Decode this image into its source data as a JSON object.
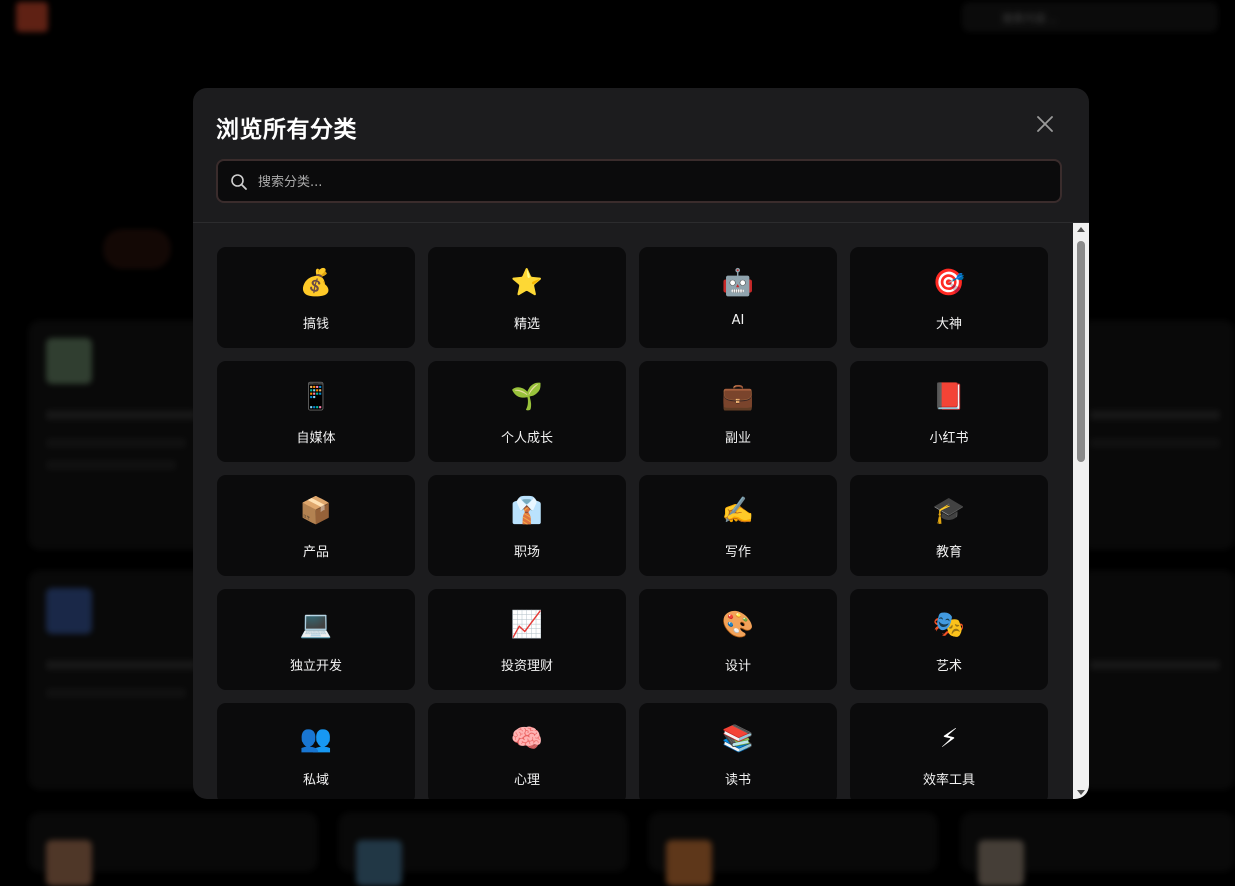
{
  "background": {
    "search_placeholder": "搜索内容..."
  },
  "modal": {
    "title": "浏览所有分类",
    "search": {
      "placeholder": "搜索分类...",
      "value": ""
    },
    "categories": [
      {
        "emoji": "💰",
        "label": "搞钱"
      },
      {
        "emoji": "⭐",
        "label": "精选"
      },
      {
        "emoji": "🤖",
        "label": "AI"
      },
      {
        "emoji": "🎯",
        "label": "大神"
      },
      {
        "emoji": "📱",
        "label": "自媒体"
      },
      {
        "emoji": "🌱",
        "label": "个人成长"
      },
      {
        "emoji": "💼",
        "label": "副业"
      },
      {
        "emoji": "📕",
        "label": "小红书"
      },
      {
        "emoji": "📦",
        "label": "产品"
      },
      {
        "emoji": "👔",
        "label": "职场"
      },
      {
        "emoji": "✍️",
        "label": "写作"
      },
      {
        "emoji": "🎓",
        "label": "教育"
      },
      {
        "emoji": "💻",
        "label": "独立开发"
      },
      {
        "emoji": "📈",
        "label": "投资理财"
      },
      {
        "emoji": "🎨",
        "label": "设计"
      },
      {
        "emoji": "🎭",
        "label": "艺术"
      },
      {
        "emoji": "👥",
        "label": "私域"
      },
      {
        "emoji": "🧠",
        "label": "心理"
      },
      {
        "emoji": "📚",
        "label": "读书"
      },
      {
        "emoji": "⚡",
        "label": "效率工具"
      }
    ]
  }
}
